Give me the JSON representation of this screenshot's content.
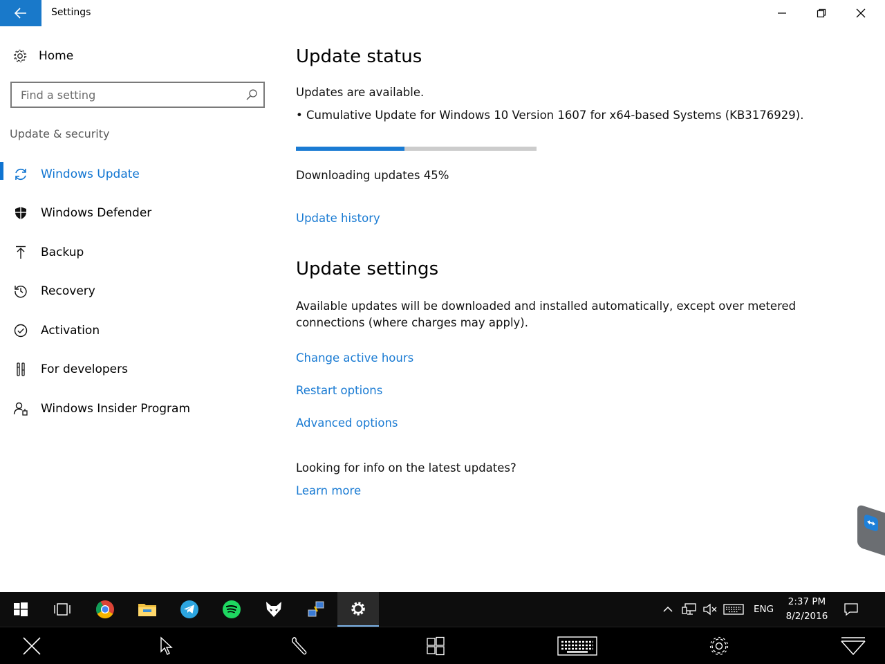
{
  "window": {
    "title": "Settings"
  },
  "sidebar": {
    "home_label": "Home",
    "search_placeholder": "Find a setting",
    "section_label": "Update & security",
    "items": [
      {
        "label": "Windows Update",
        "icon": "refresh-icon",
        "active": true
      },
      {
        "label": "Windows Defender",
        "icon": "shield-icon",
        "active": false
      },
      {
        "label": "Backup",
        "icon": "upload-arrow-icon",
        "active": false
      },
      {
        "label": "Recovery",
        "icon": "history-icon",
        "active": false
      },
      {
        "label": "Activation",
        "icon": "check-circle-icon",
        "active": false
      },
      {
        "label": "For developers",
        "icon": "developer-tools-icon",
        "active": false
      },
      {
        "label": "Windows Insider Program",
        "icon": "insider-person-icon",
        "active": false
      }
    ]
  },
  "main": {
    "update_status": {
      "heading": "Update status",
      "available_text": "Updates are available.",
      "update_item": "• Cumulative Update for Windows 10 Version 1607 for x64-based Systems (KB3176929).",
      "progress_percent": 45,
      "progress_text": "Downloading updates 45%",
      "history_link": "Update history"
    },
    "update_settings": {
      "heading": "Update settings",
      "description_line1": "Available updates will be downloaded and installed automatically, except over metered",
      "description_line2": "connections (where charges may apply).",
      "links": [
        "Change active hours",
        "Restart options",
        "Advanced options"
      ]
    },
    "info": {
      "question": "Looking for info on the latest updates?",
      "learn_more": "Learn more"
    }
  },
  "taskbar": {
    "apps": [
      "start-icon",
      "task-view-icon",
      "chrome-icon",
      "file-explorer-icon",
      "telegram-icon",
      "spotify-icon",
      "fox-app-icon",
      "network-app-icon",
      "settings-icon"
    ],
    "active_app": "settings-icon",
    "language": "ENG",
    "time": "2:37 PM",
    "date": "8/2/2016"
  },
  "remote_toolbar": {
    "icons": [
      "close-icon",
      "pointer-icon",
      "wrench-icon",
      "windows-icon",
      "keyboard-icon",
      "gear-icon",
      "dropdown-icon"
    ]
  },
  "colors": {
    "accent": "#1a7bd3",
    "back_button": "#1979ca",
    "taskbar": "#0d0d0d"
  }
}
